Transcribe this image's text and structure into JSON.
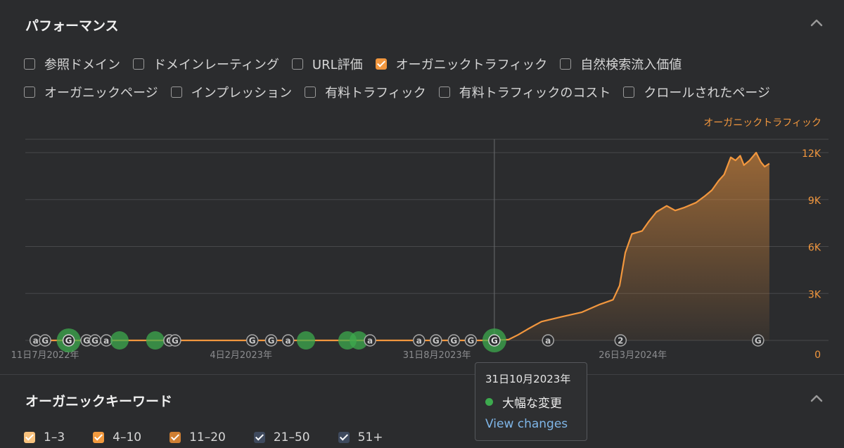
{
  "performance": {
    "title": "パフォーマンス",
    "metrics_row1": [
      {
        "label": "参照ドメイン",
        "checked": false
      },
      {
        "label": "ドメインレーティング",
        "checked": false
      },
      {
        "label": "URL評価",
        "checked": false
      },
      {
        "label": "オーガニックトラフィック",
        "checked": true
      },
      {
        "label": "自然検索流入価値",
        "checked": false
      }
    ],
    "metrics_row2": [
      {
        "label": "オーガニックページ",
        "checked": false
      },
      {
        "label": "インプレッション",
        "checked": false
      },
      {
        "label": "有料トラフィック",
        "checked": false
      },
      {
        "label": "有料トラフィックのコスト",
        "checked": false
      },
      {
        "label": "クロールされたページ",
        "checked": false
      }
    ]
  },
  "chart_data": {
    "type": "area",
    "series": [
      {
        "name": "オーガニックトラフィック",
        "color": "#f2973e"
      }
    ],
    "x_tick_labels": [
      "11日7月2022年",
      "4日2月2023年",
      "31日8月2023年",
      "26日3月2024年"
    ],
    "y_tick_labels": [
      "12K",
      "9K",
      "6K",
      "3K",
      "0"
    ],
    "ylim": [
      0,
      12000
    ],
    "grid": true,
    "points": [
      [
        "2022-07-01",
        0
      ],
      [
        "2023-10-31",
        0
      ],
      [
        "2023-11-01",
        20
      ],
      [
        "2023-11-15",
        50
      ],
      [
        "2023-11-25",
        350
      ],
      [
        "2023-12-05",
        700
      ],
      [
        "2023-12-20",
        1200
      ],
      [
        "2024-01-10",
        1500
      ],
      [
        "2024-02-01",
        1800
      ],
      [
        "2024-02-20",
        2300
      ],
      [
        "2024-03-05",
        2600
      ],
      [
        "2024-03-12",
        3500
      ],
      [
        "2024-03-18",
        5600
      ],
      [
        "2024-03-25",
        6800
      ],
      [
        "2024-04-05",
        7000
      ],
      [
        "2024-04-12",
        7600
      ],
      [
        "2024-04-20",
        8200
      ],
      [
        "2024-05-01",
        8600
      ],
      [
        "2024-05-10",
        8300
      ],
      [
        "2024-05-20",
        8500
      ],
      [
        "2024-06-01",
        8800
      ],
      [
        "2024-06-10",
        9200
      ],
      [
        "2024-06-18",
        9600
      ],
      [
        "2024-06-25",
        10200
      ],
      [
        "2024-07-01",
        10600
      ],
      [
        "2024-07-08",
        11700
      ],
      [
        "2024-07-13",
        11500
      ],
      [
        "2024-07-18",
        11800
      ],
      [
        "2024-07-22",
        11200
      ],
      [
        "2024-07-28",
        11500
      ],
      [
        "2024-08-04",
        12000
      ],
      [
        "2024-08-09",
        11400
      ],
      [
        "2024-08-13",
        11100
      ],
      [
        "2024-08-18",
        11300
      ]
    ],
    "hover_date": "2023-10-31",
    "annotations": [
      {
        "date": "2022-07-01",
        "kind": "letter",
        "text": "a"
      },
      {
        "date": "2022-07-11",
        "kind": "letter",
        "text": "G"
      },
      {
        "date": "2022-08-05",
        "kind": "change",
        "size": "large",
        "text": "G"
      },
      {
        "date": "2022-08-24",
        "kind": "letter",
        "text": "G"
      },
      {
        "date": "2022-09-02",
        "kind": "letter",
        "text": "G"
      },
      {
        "date": "2022-09-14",
        "kind": "letter",
        "text": "a"
      },
      {
        "date": "2022-09-28",
        "kind": "change",
        "size": "medium",
        "text": ""
      },
      {
        "date": "2022-11-05",
        "kind": "change",
        "size": "medium",
        "text": ""
      },
      {
        "date": "2022-11-20",
        "kind": "letter",
        "text": "G"
      },
      {
        "date": "2022-11-26",
        "kind": "letter",
        "text": "G"
      },
      {
        "date": "2023-02-16",
        "kind": "letter",
        "text": "G"
      },
      {
        "date": "2023-03-08",
        "kind": "letter",
        "text": "G"
      },
      {
        "date": "2023-03-26",
        "kind": "letter",
        "text": "a"
      },
      {
        "date": "2023-04-14",
        "kind": "change",
        "size": "medium",
        "text": ""
      },
      {
        "date": "2023-05-28",
        "kind": "change",
        "size": "medium",
        "text": ""
      },
      {
        "date": "2023-06-09",
        "kind": "change",
        "size": "medium",
        "text": ""
      },
      {
        "date": "2023-06-21",
        "kind": "letter",
        "text": "a"
      },
      {
        "date": "2023-08-12",
        "kind": "letter",
        "text": "a"
      },
      {
        "date": "2023-08-30",
        "kind": "letter",
        "text": "G"
      },
      {
        "date": "2023-09-18",
        "kind": "letter",
        "text": "G"
      },
      {
        "date": "2023-10-06",
        "kind": "letter",
        "text": "G"
      },
      {
        "date": "2023-10-31",
        "kind": "change",
        "size": "large",
        "text": "G"
      },
      {
        "date": "2023-12-27",
        "kind": "letter",
        "text": "a"
      },
      {
        "date": "2024-03-13",
        "kind": "letter",
        "text": "2"
      },
      {
        "date": "2024-08-06",
        "kind": "letter",
        "text": "G"
      }
    ]
  },
  "tooltip": {
    "date": "31日10月2023年",
    "event": "大幅な変更",
    "link": "View changes"
  },
  "keywords": {
    "title": "オーガニックキーワード",
    "ranges": [
      "1–3",
      "4–10",
      "11–20",
      "21–50",
      "51+"
    ]
  },
  "colors": {
    "accent": "#f2973e",
    "change": "#3daa4e",
    "background": "#2b2c2e"
  }
}
